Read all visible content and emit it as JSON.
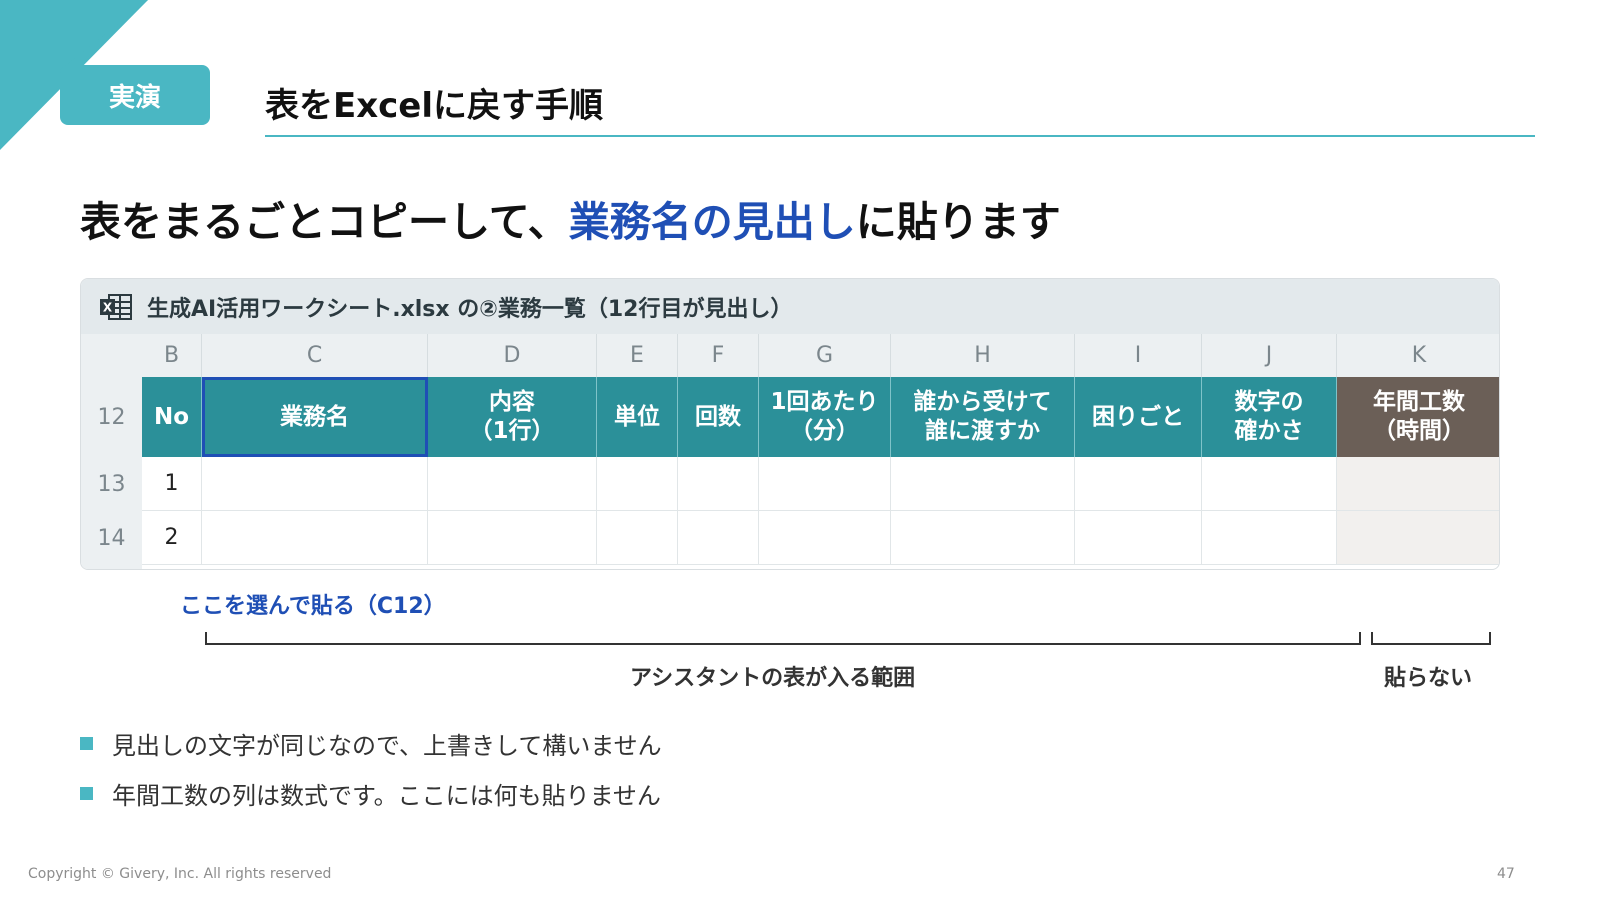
{
  "colors": {
    "accent": "#4ab7c3",
    "highlight": "#1f4fb5",
    "header_teal": "#2b9099",
    "header_brown": "#6b5f57"
  },
  "badge": "実演",
  "slide_title": "表をExcelに戻す手順",
  "headline": {
    "part1": "表をまるごとコピーして、",
    "highlight": "業務名の見出し",
    "part2": "に貼ります"
  },
  "sheet": {
    "icon": "excel-icon",
    "file_label": "生成AI活用ワークシート.xlsx の②業務一覧（12行目が見出し）",
    "columns": [
      "B",
      "C",
      "D",
      "E",
      "F",
      "G",
      "H",
      "I",
      "J",
      "K"
    ],
    "rows": [
      "12",
      "13",
      "14"
    ],
    "headers": [
      "No",
      "業務名",
      "内容\n（1行）",
      "単位",
      "回数",
      "1回あたり\n（分）",
      "誰から受けて\n誰に渡すか",
      "困りごと",
      "数字の\n確かさ",
      "年間工数\n（時間）"
    ],
    "data_rows": [
      [
        "1"
      ],
      [
        "2"
      ]
    ],
    "selected_cell": "C12"
  },
  "annotations": {
    "select_caption": "ここを選んで貼る（C12）",
    "range_label": "アシスタントの表が入る範囲",
    "no_paste_label": "貼らない"
  },
  "bullets": [
    "見出しの文字が同じなので、上書きして構いません",
    "年間工数の列は数式です。ここには何も貼りません"
  ],
  "footer": {
    "copyright": "Copyright © Givery, Inc. All rights reserved",
    "page": "47"
  }
}
